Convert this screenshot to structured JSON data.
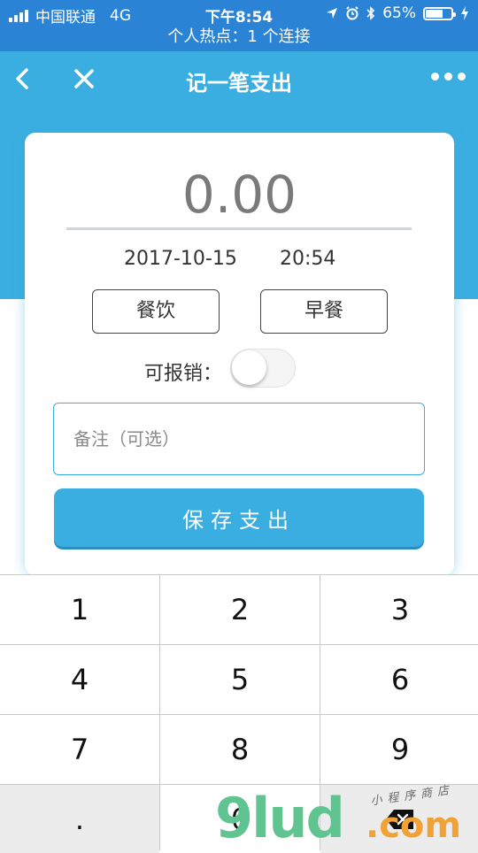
{
  "status": {
    "carrier": "中国联通",
    "network": "4G",
    "time": "下午8:54",
    "battery": "65%"
  },
  "hotspot": {
    "text": "个人热点：1 个连接"
  },
  "nav": {
    "title": "记一笔支出"
  },
  "form": {
    "amount": "0.00",
    "date": "2017-10-15",
    "time": "20:54",
    "category": "餐饮",
    "subcategory": "早餐",
    "reimbursable_label": "可报销：",
    "reimbursable": false,
    "note_placeholder": "备注（可选）",
    "note_value": "",
    "save_label": "保存支出"
  },
  "keypad": {
    "keys": [
      "1",
      "2",
      "3",
      "4",
      "5",
      "6",
      "7",
      "8",
      "9",
      ".",
      "0"
    ],
    "backspace_icon": "backspace-icon"
  },
  "watermark": {
    "logo": "9lud",
    "domain": ".com",
    "tag": "小程序商店"
  },
  "colors": {
    "status_bar": "#2b83d6",
    "accent": "#3aaee0",
    "amount_text": "#7a7a7a"
  }
}
